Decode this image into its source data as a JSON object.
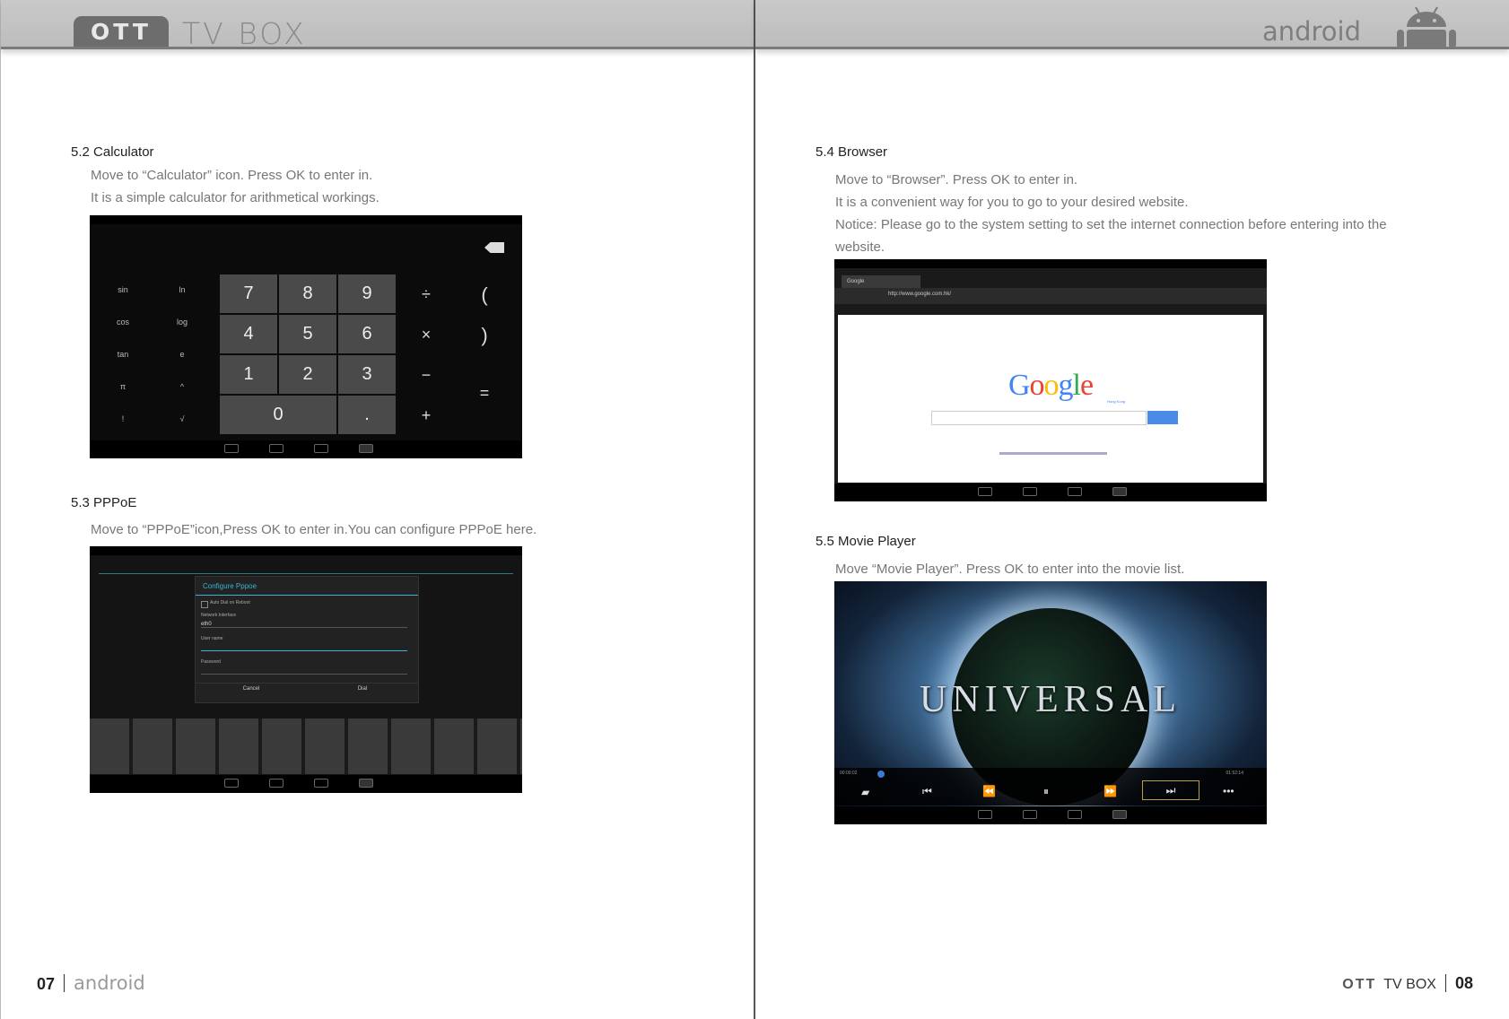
{
  "header": {
    "brand_badge": "OTT",
    "brand_text": "TV BOX",
    "platform": "android"
  },
  "left_page": {
    "sections": [
      {
        "title": "5.2 Calculator",
        "lines": [
          "Move to “Calculator” icon. Press OK to enter in.",
          "It is a simple calculator for arithmetical workings."
        ]
      },
      {
        "title": "5.3 PPPoE",
        "lines": [
          "Move to “PPPoE”icon,Press OK to enter in.You can configure PPPoE here."
        ]
      }
    ],
    "footer": {
      "page_number": "07",
      "word": "android"
    }
  },
  "right_page": {
    "sections": [
      {
        "title": "5.4 Browser",
        "lines": [
          "Move to “Browser”. Press OK to enter in.",
          "It is a convenient way for you to go to your desired website.",
          "Notice: Please go to the system setting to set the internet connection before entering into the",
          "website."
        ]
      },
      {
        "title": "5.5 Movie Player",
        "lines": [
          "Move “Movie Player”. Press OK to enter into the movie list."
        ]
      }
    ],
    "footer": {
      "brand": "OTT",
      "text": "TV BOX",
      "page_number": "08"
    }
  },
  "calculator": {
    "digits": [
      "7",
      "8",
      "9",
      "4",
      "5",
      "6",
      "1",
      "2",
      "3",
      "0",
      "."
    ],
    "functions": [
      "sin",
      "ln",
      "cos",
      "log",
      "tan",
      "e",
      "π",
      "^",
      "!",
      "√"
    ],
    "operators": [
      "÷",
      "×",
      "−",
      "+"
    ],
    "parens": [
      "(",
      ")"
    ],
    "equals": "="
  },
  "pppoe_dialog": {
    "title": "Configure Pppoe",
    "checkbox": "Auto Dial on Reboot",
    "iface_label": "Network Interface",
    "iface_value": "eth0",
    "user_label": "User name",
    "pass_label": "Password",
    "cancel": "Cancel",
    "dial": "Dial"
  },
  "browser": {
    "tab_title": "Google",
    "url": "http://www.google.com.hk/",
    "logo": "Google",
    "logo_sub": "Hong Kong",
    "search_btn": "🔍"
  },
  "movie": {
    "title_text": "UNIVERSAL",
    "time_left": "00:00:02",
    "time_right": "01:52:14"
  },
  "colors": {
    "header_bg": "#c4c4c4",
    "google_blue": "#4285f4",
    "google_red": "#ea4335",
    "google_yellow": "#fbbc05",
    "google_green": "#34a853"
  }
}
